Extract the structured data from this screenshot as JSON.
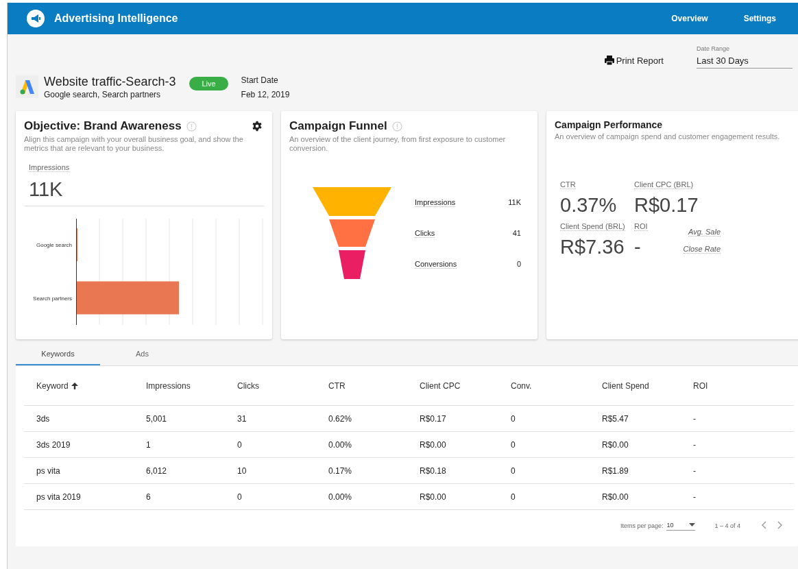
{
  "app_bar": {
    "title": "Advertising Intelligence",
    "nav": [
      {
        "label": "Overview"
      },
      {
        "label": "Settings"
      }
    ]
  },
  "toolbar": {
    "print_label": "Print Report",
    "date_range": {
      "label": "Date Range",
      "value": "Last 30 Days"
    }
  },
  "campaign": {
    "name": "Website traffic-Search-3",
    "networks": "Google search, Search partners",
    "status": "Live",
    "start_date_label": "Start Date",
    "start_date": "Feb 12, 2019"
  },
  "objective_card": {
    "title": "Objective: Brand Awareness",
    "description": "Align this campaign with your overall business goal, and show the metrics that are relevant to your business.",
    "metric_label": "Impressions",
    "metric_value": "11K",
    "bar_labels": [
      "Google search",
      "Search partners"
    ]
  },
  "funnel_card": {
    "title": "Campaign Funnel",
    "description": "An overview of the client journey, from first exposure to customer conversion.",
    "stages": [
      {
        "label": "Impressions",
        "value": "11K",
        "color": "#ffb300"
      },
      {
        "label": "Clicks",
        "value": "41",
        "color": "#ff7043"
      },
      {
        "label": "Conversions",
        "value": "0",
        "color": "#e91e63"
      }
    ]
  },
  "performance_card": {
    "title": "Campaign Performance",
    "description": "An overview of campaign spend and customer engagement results.",
    "metrics": [
      {
        "label": "CTR",
        "value": "0.37%"
      },
      {
        "label": "Client CPC (BRL)",
        "value": "R$0.17"
      },
      {
        "label": "Client Spend (BRL)",
        "value": "R$7.36"
      },
      {
        "label": "ROI",
        "value": "-"
      }
    ],
    "links": [
      "Avg. Sale",
      "Close Rate"
    ]
  },
  "tabs": [
    {
      "label": "Keywords",
      "selected": true
    },
    {
      "label": "Ads",
      "selected": false
    }
  ],
  "table": {
    "columns": [
      {
        "label": "Keyword",
        "sorted": true
      },
      {
        "label": "Impressions",
        "sorted": false
      },
      {
        "label": "Clicks",
        "sorted": false
      },
      {
        "label": "CTR",
        "sorted": false
      },
      {
        "label": "Client CPC",
        "sorted": false
      },
      {
        "label": "Conv.",
        "sorted": false
      },
      {
        "label": "Client Spend",
        "sorted": false
      },
      {
        "label": "ROI",
        "sorted": false
      }
    ],
    "rows": [
      [
        "3ds",
        "5,001",
        "31",
        "0.62%",
        "R$0.17",
        "0",
        "R$5.47",
        "-"
      ],
      [
        "3ds 2019",
        "1",
        "0",
        "0.00%",
        "R$0.00",
        "0",
        "R$0.00",
        "-"
      ],
      [
        "ps vita",
        "6,012",
        "10",
        "0.17%",
        "R$0.18",
        "0",
        "R$1.89",
        "-"
      ],
      [
        "ps vita 2019",
        "6",
        "0",
        "0.00%",
        "R$0.00",
        "0",
        "R$0.00",
        "-"
      ]
    ]
  },
  "paginator": {
    "label": "Items per page:",
    "page_size": "10",
    "range": "1 – 4 of 4"
  }
}
